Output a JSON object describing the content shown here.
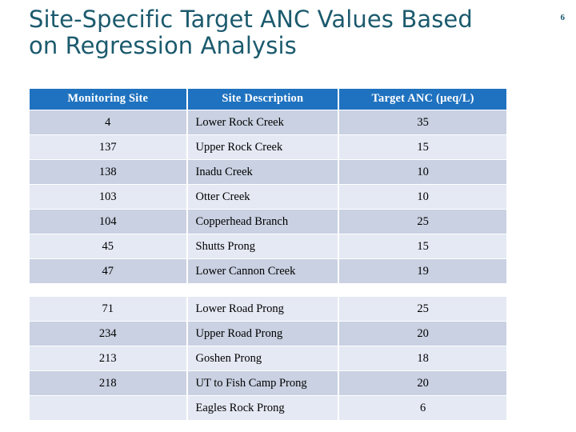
{
  "slide": {
    "title": "Site-Specific Target ANC Values Based\non Regression Analysis",
    "page_number": "6",
    "title_color": "#1b5a6d",
    "header_color": "#1f72bf",
    "row_dark_color": "#c9d1e2",
    "row_light_color": "#e5e9f4"
  },
  "table": {
    "columns": [
      {
        "label": "Monitoring Site"
      },
      {
        "label": "Site Description"
      },
      {
        "label": "Target ANC (µeq/L)"
      }
    ],
    "rows": [
      {
        "site": "4",
        "description": "Lower Rock Creek",
        "anc": "35",
        "gap_after": false
      },
      {
        "site": "137",
        "description": "Upper Rock Creek",
        "anc": "15",
        "gap_after": false
      },
      {
        "site": "138",
        "description": "Inadu Creek",
        "anc": "10",
        "gap_after": false
      },
      {
        "site": "103",
        "description": "Otter Creek",
        "anc": "10",
        "gap_after": false
      },
      {
        "site": "104",
        "description": "Copperhead Branch",
        "anc": "25",
        "gap_after": false
      },
      {
        "site": "45",
        "description": "Shutts Prong",
        "anc": "15",
        "gap_after": false
      },
      {
        "site": "47",
        "description": "Lower Cannon Creek",
        "anc": "19",
        "gap_after": true
      },
      {
        "site": "71",
        "description": "Lower Road Prong",
        "anc": "25",
        "gap_after": false
      },
      {
        "site": "234",
        "description": "Upper Road Prong",
        "anc": "20",
        "gap_after": false
      },
      {
        "site": "213",
        "description": "Goshen Prong",
        "anc": "18",
        "gap_after": false
      },
      {
        "site": "218",
        "description": "UT to Fish Camp Prong",
        "anc": "20",
        "gap_after": false
      },
      {
        "site": "",
        "description": "Eagles Rock Prong",
        "anc": "6",
        "gap_after": false
      }
    ]
  }
}
